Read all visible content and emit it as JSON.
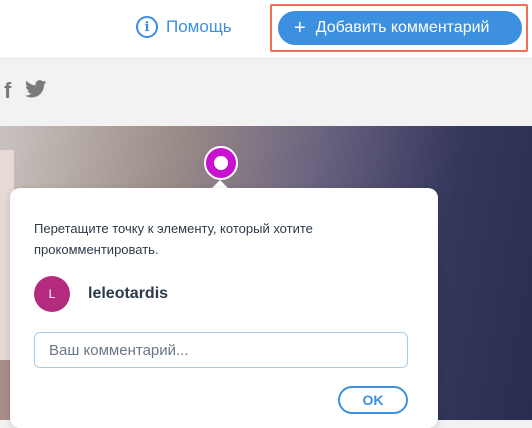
{
  "header": {
    "help_label": "Помощь",
    "add_comment_label": "Добавить комментарий"
  },
  "social": {
    "icons": [
      "facebook-icon",
      "twitter-icon"
    ]
  },
  "popup": {
    "instruction": "Перетащите точку к элементу, который хотите прокомментировать.",
    "user": {
      "avatar_initial": "L",
      "name": "leleotardis"
    },
    "comment_placeholder": "Ваш комментарий...",
    "ok_label": "OK"
  },
  "colors": {
    "accent": "#3d8fe0",
    "highlight_border": "#f07055",
    "pin": "#c812d0",
    "avatar": "#b42a7e"
  }
}
